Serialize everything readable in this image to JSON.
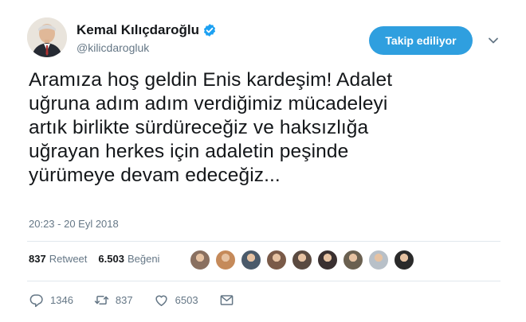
{
  "user": {
    "display_name": "Kemal Kılıçdaroğlu",
    "handle": "@kilicdarogluk",
    "verified": true
  },
  "follow_button": {
    "label": "Takip ediliyor"
  },
  "tweet": {
    "lines": [
      "Aramıza hoş geldin Enis kardeşim! Adalet",
      "uğruna adım adım verdiğimiz mücadeleyi",
      "artık birlikte sürdüreceğiz ve haksızlığa",
      "uğrayan herkes için adaletin peşinde",
      "yürümeye devam edeceğiz..."
    ],
    "timestamp": "20:23 - 20 Eyl 2018"
  },
  "stats": {
    "retweet_count": "837",
    "retweet_label": "Retweet",
    "like_count": "6.503",
    "like_label": "Beğeni"
  },
  "liker_avatar_colors": [
    "#8a7060",
    "#c58a5a",
    "#4a5a6a",
    "#7a5a48",
    "#5a4a40",
    "#3a3030",
    "#6a6050",
    "#b8c0c8",
    "#2a2a2a"
  ],
  "actions": {
    "reply_count": "1346",
    "retweet_count": "837",
    "like_count": "6503"
  },
  "colors": {
    "accent": "#2f9fdf",
    "verified": "#1da1f2",
    "muted": "#657786"
  }
}
